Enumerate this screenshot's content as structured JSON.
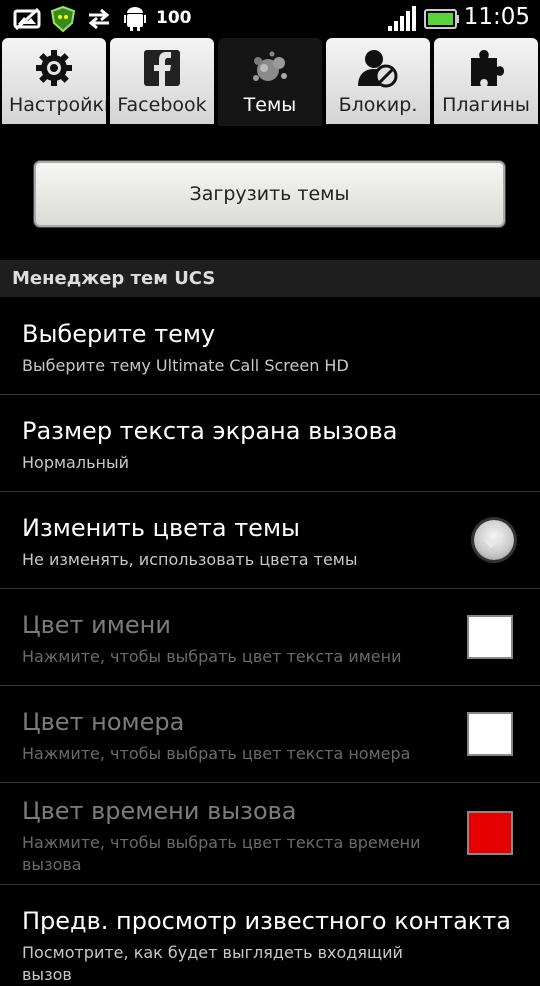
{
  "status_bar": {
    "battery_percent": "100",
    "time": "11:05",
    "icons": [
      "photo-icon",
      "shield-app-icon",
      "sync-arrows-icon",
      "android-icon",
      "signal-icon",
      "battery-icon"
    ]
  },
  "tabs": [
    {
      "label": "Настройки",
      "icon": "gear-icon",
      "active": false
    },
    {
      "label": "Facebook",
      "icon": "facebook-icon",
      "active": false
    },
    {
      "label": "Темы",
      "icon": "paint-splash-icon",
      "active": true
    },
    {
      "label": "Блокир.",
      "icon": "block-user-icon",
      "active": false
    },
    {
      "label": "Плагины",
      "icon": "puzzle-icon",
      "active": false
    }
  ],
  "load_button": {
    "label": "Загрузить темы"
  },
  "section": {
    "title": "Менеджер тем UCS"
  },
  "prefs": [
    {
      "title": "Выберите тему",
      "summary": "Выберите тему Ultimate Call Screen HD",
      "enabled": true
    },
    {
      "title": "Размер текста экрана вызова",
      "summary": "Нормальный",
      "enabled": true
    },
    {
      "title": "Изменить цвета темы",
      "summary": "Не изменять, использовать цвета темы",
      "enabled": true,
      "toggle": true
    },
    {
      "title": "Цвет имени",
      "summary": "Нажмите, чтобы выбрать цвет текста имени",
      "enabled": false,
      "color": "#ffffff"
    },
    {
      "title": "Цвет номера",
      "summary": "Нажмите, чтобы выбрать цвет текста номера",
      "enabled": false,
      "color": "#ffffff"
    },
    {
      "title": "Цвет времени вызова",
      "summary": "Нажмите, чтобы выбрать цвет текста времени вызова",
      "enabled": false,
      "color": "#e60000"
    },
    {
      "title": "Предв. просмотр известного контакта",
      "summary": "Посмотрите, как будет выглядеть входящий вызов",
      "enabled": true
    }
  ]
}
